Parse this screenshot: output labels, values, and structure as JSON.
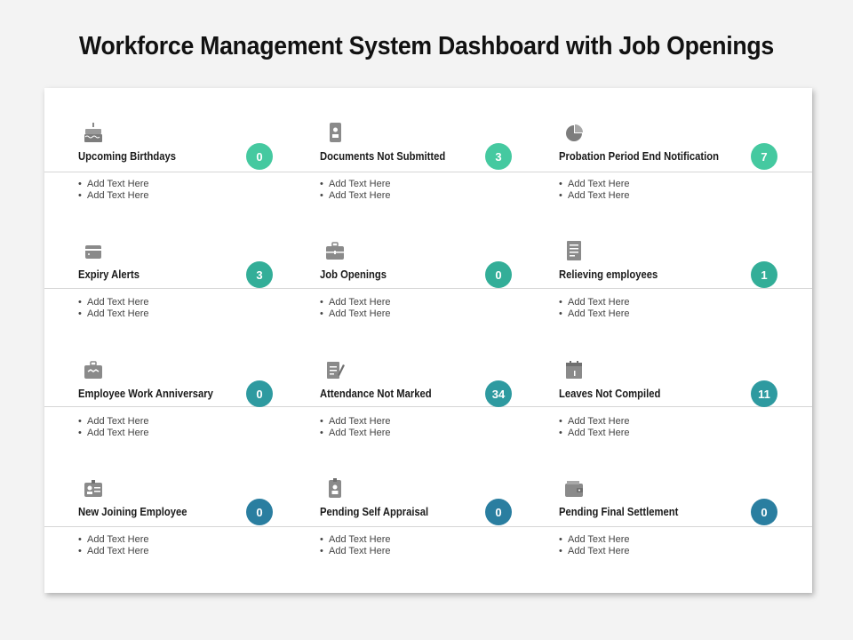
{
  "title": "Workforce Management System Dashboard with Job Openings",
  "colors": {
    "row1": "#45c9a0",
    "row2": "#33ae98",
    "row3": "#2e9aa0",
    "row4": "#2a7ea0",
    "icon": "#8a8a8a"
  },
  "rows": [
    {
      "cards": [
        {
          "label": "Upcoming Birthdays",
          "count": "0",
          "icon": "birthday-cake-icon",
          "items": [
            "Add Text Here",
            "Add Text Here"
          ]
        },
        {
          "label": "Documents Not Submitted",
          "count": "3",
          "icon": "document-icon",
          "items": [
            "Add Text Here",
            "Add Text Here"
          ]
        },
        {
          "label": "Probation Period End Notification",
          "count": "7",
          "icon": "pie-chart-icon",
          "items": [
            "Add Text Here",
            "Add Text Here"
          ]
        }
      ]
    },
    {
      "cards": [
        {
          "label": "Expiry Alerts",
          "count": "3",
          "icon": "wallet-icon",
          "items": [
            "Add Text Here",
            "Add Text Here"
          ]
        },
        {
          "label": "Job Openings",
          "count": "0",
          "icon": "briefcase-icon",
          "items": [
            "Add Text Here",
            "Add Text Here"
          ]
        },
        {
          "label": "Relieving employees",
          "count": "1",
          "icon": "list-document-icon",
          "items": [
            "Add Text Here",
            "Add Text Here"
          ]
        }
      ]
    },
    {
      "cards": [
        {
          "label": "Employee Work Anniversary",
          "count": "0",
          "icon": "handshake-briefcase-icon",
          "items": [
            "Add Text Here",
            "Add Text Here"
          ]
        },
        {
          "label": "Attendance Not Marked",
          "count": "34",
          "icon": "checklist-pen-icon",
          "items": [
            "Add Text Here",
            "Add Text Here"
          ]
        },
        {
          "label": "Leaves Not Compiled",
          "count": "11",
          "icon": "calendar-icon",
          "items": [
            "Add Text Here",
            "Add Text Here"
          ]
        }
      ]
    },
    {
      "cards": [
        {
          "label": "New Joining Employee",
          "count": "0",
          "icon": "id-card-icon",
          "items": [
            "Add Text Here",
            "Add Text Here"
          ]
        },
        {
          "label": "Pending Self Appraisal",
          "count": "0",
          "icon": "id-badge-icon",
          "items": [
            "Add Text Here",
            "Add Text Here"
          ]
        },
        {
          "label": "Pending Final Settlement",
          "count": "0",
          "icon": "cash-wallet-icon",
          "items": [
            "Add Text Here",
            "Add Text Here"
          ]
        }
      ]
    }
  ]
}
